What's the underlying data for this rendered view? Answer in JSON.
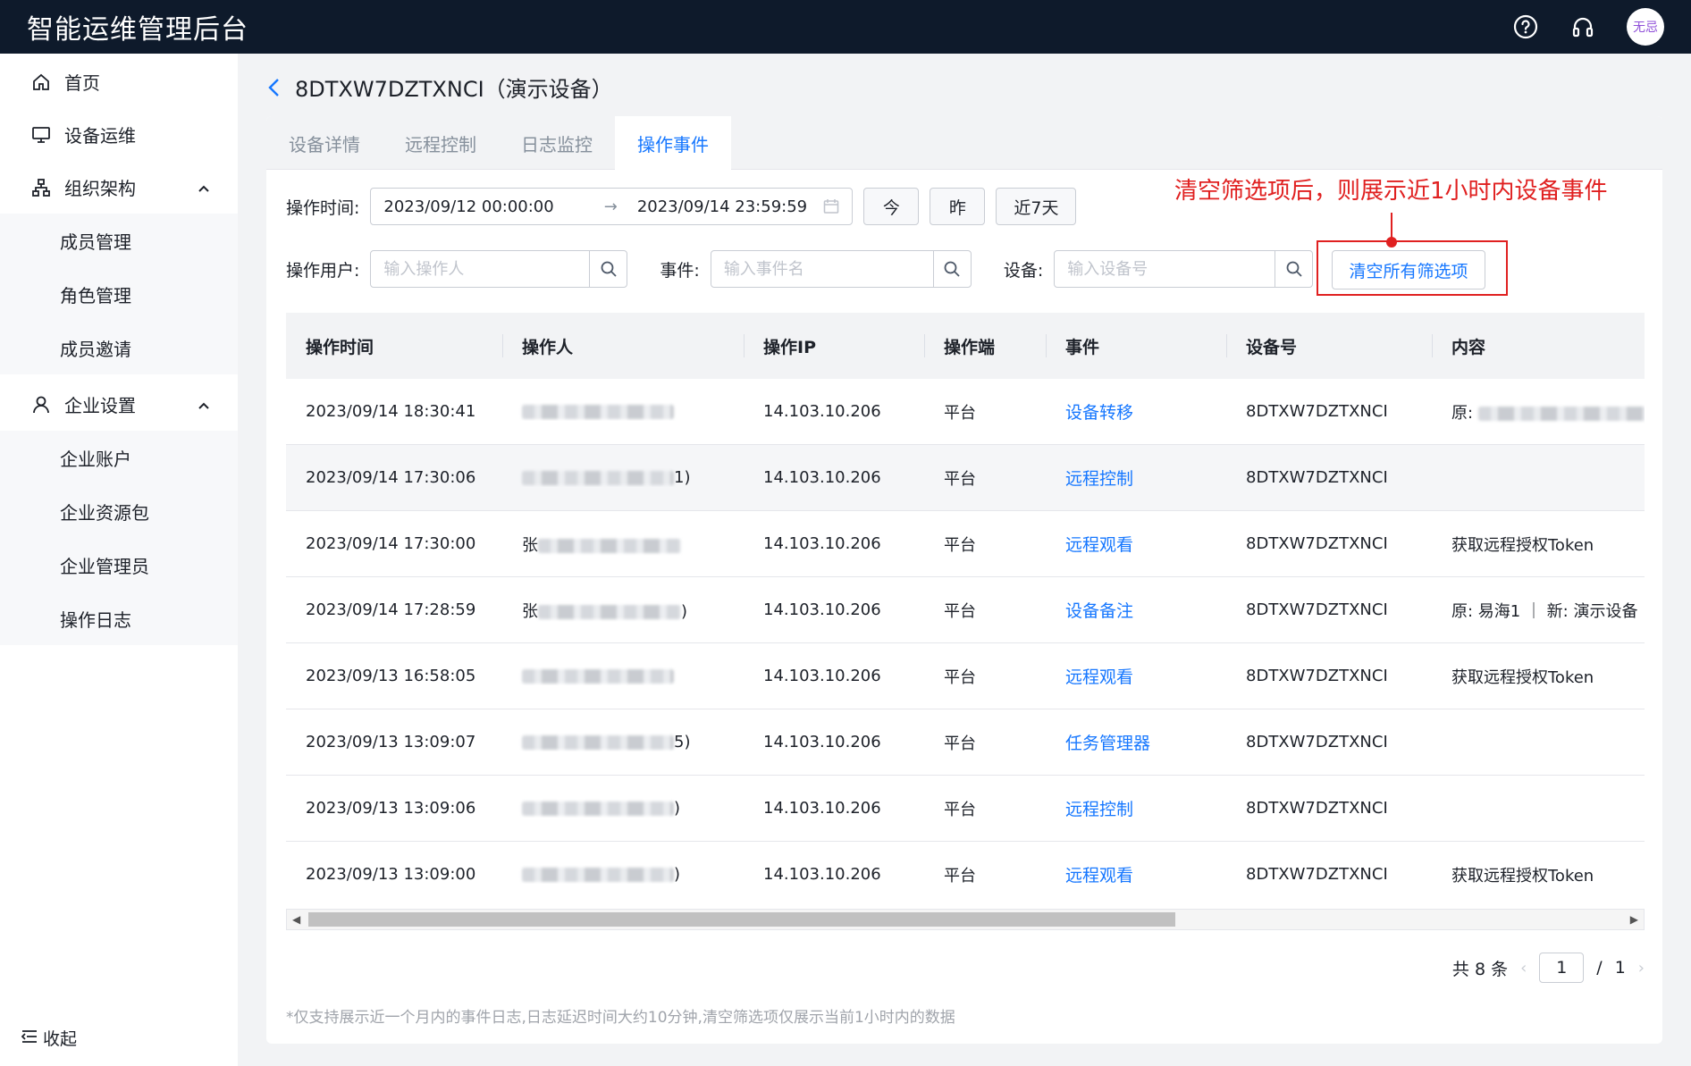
{
  "header": {
    "title": "智能运维管理后台",
    "avatar_text": "无忌"
  },
  "sidebar": {
    "items": [
      {
        "label": "首页",
        "icon": "home-icon"
      },
      {
        "label": "设备运维",
        "icon": "monitor-icon"
      },
      {
        "label": "组织架构",
        "icon": "org-icon",
        "expanded": true,
        "children": [
          "成员管理",
          "角色管理",
          "成员邀请"
        ]
      },
      {
        "label": "企业设置",
        "icon": "user-icon",
        "expanded": true,
        "children": [
          "企业账户",
          "企业资源包",
          "企业管理员",
          "操作日志"
        ]
      }
    ],
    "collapse_label": "收起"
  },
  "page": {
    "title": "8DTXW7DZTXNCI（演示设备）"
  },
  "tabs": [
    {
      "label": "设备详情",
      "active": false
    },
    {
      "label": "远程控制",
      "active": false
    },
    {
      "label": "日志监控",
      "active": false
    },
    {
      "label": "操作事件",
      "active": true
    }
  ],
  "filters": {
    "time_label": "操作时间:",
    "date_start": "2023/09/12 00:00:00",
    "date_end": "2023/09/14 23:59:59",
    "quick": [
      "今",
      "昨",
      "近7天"
    ],
    "user_label": "操作用户:",
    "user_placeholder": "输入操作人",
    "event_label": "事件:",
    "event_placeholder": "输入事件名",
    "device_label": "设备:",
    "device_placeholder": "输入设备号",
    "clear_label": "清空所有筛选项"
  },
  "annotation": {
    "text": "清空筛选项后，则展示近1小时内设备事件",
    "color": "#e02020"
  },
  "table": {
    "columns": [
      "操作时间",
      "操作人",
      "操作IP",
      "操作端",
      "事件",
      "设备号",
      "内容"
    ],
    "rows": [
      {
        "time": "2023/09/14 18:30:41",
        "operator_suffix": "",
        "ip": "14.103.10.206",
        "client": "平台",
        "event": "设备转移",
        "device": "8DTXW7DZTXNCI",
        "content": "原:",
        "content_blurred": true
      },
      {
        "time": "2023/09/14 17:30:06",
        "operator_suffix": "1)",
        "ip": "14.103.10.206",
        "client": "平台",
        "event": "远程控制",
        "device": "8DTXW7DZTXNCI",
        "content": "",
        "content_blurred": false
      },
      {
        "time": "2023/09/14 17:30:00",
        "operator_prefix": "张",
        "operator_suffix": "",
        "ip": "14.103.10.206",
        "client": "平台",
        "event": "远程观看",
        "device": "8DTXW7DZTXNCI",
        "content": "获取远程授权Token",
        "content_blurred": false
      },
      {
        "time": "2023/09/14 17:28:59",
        "operator_prefix": "张",
        "operator_suffix": ")",
        "ip": "14.103.10.206",
        "client": "平台",
        "event": "设备备注",
        "device": "8DTXW7DZTXNCI",
        "content": "原: 易海1 ｜ 新: 演示设备",
        "content_blurred": false
      },
      {
        "time": "2023/09/13 16:58:05",
        "operator_suffix": "",
        "ip": "14.103.10.206",
        "client": "平台",
        "event": "远程观看",
        "device": "8DTXW7DZTXNCI",
        "content": "获取远程授权Token",
        "content_blurred": false
      },
      {
        "time": "2023/09/13 13:09:07",
        "operator_suffix": "5)",
        "ip": "14.103.10.206",
        "client": "平台",
        "event": "任务管理器",
        "device": "8DTXW7DZTXNCI",
        "content": "",
        "content_blurred": false
      },
      {
        "time": "2023/09/13 13:09:06",
        "operator_suffix": ")",
        "ip": "14.103.10.206",
        "client": "平台",
        "event": "远程控制",
        "device": "8DTXW7DZTXNCI",
        "content": "",
        "content_blurred": false
      },
      {
        "time": "2023/09/13 13:09:00",
        "operator_suffix": ")",
        "ip": "14.103.10.206",
        "client": "平台",
        "event": "远程观看",
        "device": "8DTXW7DZTXNCI",
        "content": "获取远程授权Token",
        "content_blurred": false
      }
    ]
  },
  "pagination": {
    "total_label": "共 8 条",
    "current_page": "1",
    "separator": "/",
    "total_pages": "1"
  },
  "footnote": "*仅支持展示近一个月内的事件日志,日志延迟时间大约10分钟,清空筛选项仅展示当前1小时内的数据",
  "colors": {
    "topbar": "#0e1a2b",
    "accent": "#1677ff",
    "annotation": "#e02020"
  }
}
